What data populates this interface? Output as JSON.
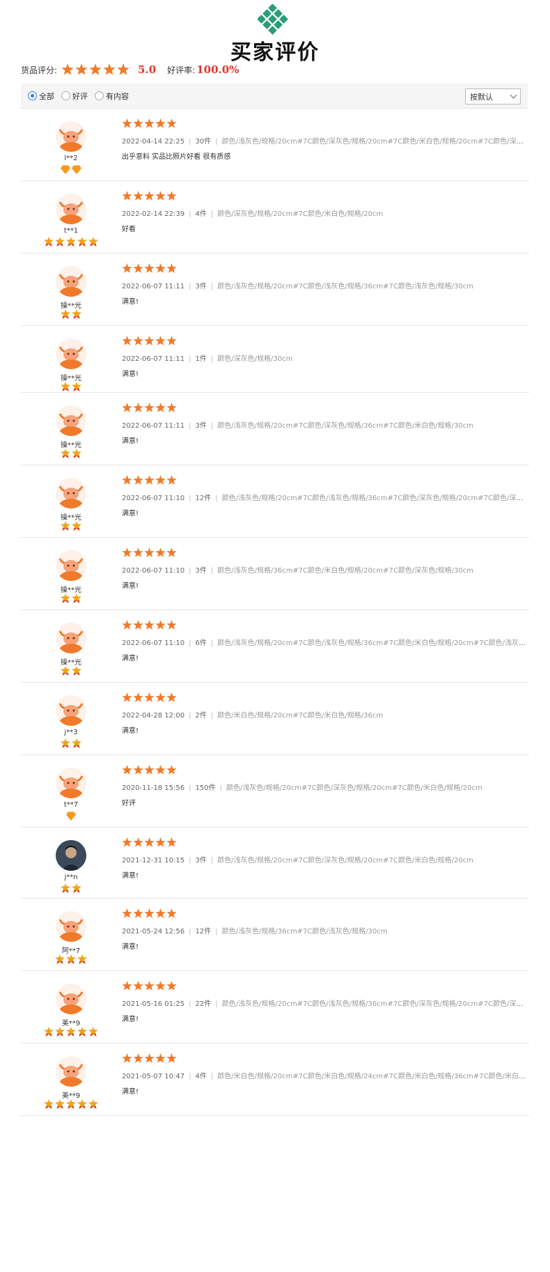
{
  "title": "买家评价",
  "summary": {
    "label": "货品评分:",
    "score": "5.0",
    "rate_label": "好评率:",
    "rate": "100.0%"
  },
  "filters": {
    "all": "全部",
    "good": "好评",
    "has_content": "有内容",
    "sort": "按默认"
  },
  "colors": {
    "accent": "#f07a29",
    "red": "#e6332a",
    "logo": "#2a9d78"
  },
  "reviews": [
    {
      "name": "l**2",
      "badge": "diamond",
      "badge_count": 2,
      "date": "2022-04-14 22:25",
      "qty": "30件",
      "spec": "颜色/浅灰色/规格/20cm#7C颜色/深灰色/规格/20cm#7C颜色/米白色/规格/20cm#7C颜色/深灰色/规格/...",
      "content": "出乎意料 实品比照片好看 很有质感"
    },
    {
      "name": "t**1",
      "badge": "crown",
      "badge_count": 5,
      "date": "2022-02-14 22:39",
      "qty": "4件",
      "spec": "颜色/深灰色/规格/20cm#7C颜色/米白色/规格/20cm",
      "content": "好看"
    },
    {
      "name": "操**光",
      "badge": "crown",
      "badge_count": 2,
      "date": "2022-06-07 11:11",
      "qty": "3件",
      "spec": "颜色/浅灰色/规格/20cm#7C颜色/浅灰色/规格/36cm#7C颜色/浅灰色/规格/30cm",
      "content": "满意!"
    },
    {
      "name": "操**光",
      "badge": "crown",
      "badge_count": 2,
      "date": "2022-06-07 11:11",
      "qty": "1件",
      "spec": "颜色/深灰色/规格/30cm",
      "content": "满意!"
    },
    {
      "name": "操**光",
      "badge": "crown",
      "badge_count": 2,
      "date": "2022-06-07 11:11",
      "qty": "3件",
      "spec": "颜色/浅灰色/规格/20cm#7C颜色/深灰色/规格/36cm#7C颜色/米白色/规格/30cm",
      "content": "满意!"
    },
    {
      "name": "操**光",
      "badge": "crown",
      "badge_count": 2,
      "date": "2022-06-07 11:10",
      "qty": "12件",
      "spec": "颜色/浅灰色/规格/20cm#7C颜色/浅灰色/规格/36cm#7C颜色/深灰色/规格/20cm#7C颜色/深灰色/规格/...",
      "content": "满意!"
    },
    {
      "name": "操**光",
      "badge": "crown",
      "badge_count": 2,
      "date": "2022-06-07 11:10",
      "qty": "3件",
      "spec": "颜色/浅灰色/规格/36cm#7C颜色/米白色/规格/20cm#7C颜色/深灰色/规格/30cm",
      "content": "满意!"
    },
    {
      "name": "操**光",
      "badge": "crown",
      "badge_count": 2,
      "date": "2022-06-07 11:10",
      "qty": "6件",
      "spec": "颜色/浅灰色/规格/20cm#7C颜色/浅灰色/规格/36cm#7C颜色/米白色/规格/20cm#7C颜色/浅灰色/规格/3...",
      "content": "满意!"
    },
    {
      "name": "j**3",
      "badge": "crown",
      "badge_count": 2,
      "date": "2022-04-28 12:00",
      "qty": "2件",
      "spec": "颜色/米白色/规格/20cm#7C颜色/米白色/规格/36cm",
      "content": "满意!"
    },
    {
      "name": "t**7",
      "badge": "diamond",
      "badge_count": 1,
      "date": "2020-11-18 15:56",
      "qty": "150件",
      "spec": "颜色/浅灰色/规格/20cm#7C颜色/深灰色/规格/20cm#7C颜色/米白色/规格/20cm",
      "content": "好评"
    },
    {
      "name": "j**n",
      "badge": "crown",
      "badge_count": 2,
      "photo": true,
      "date": "2021-12-31 10:15",
      "qty": "3件",
      "spec": "颜色/浅灰色/规格/20cm#7C颜色/深灰色/规格/20cm#7C颜色/米白色/规格/20cm",
      "content": "满意!"
    },
    {
      "name": "阿**7",
      "badge": "crown",
      "badge_count": 3,
      "date": "2021-05-24 12:56",
      "qty": "12件",
      "spec": "颜色/浅灰色/规格/36cm#7C颜色/浅灰色/规格/30cm",
      "content": "满意!"
    },
    {
      "name": "美**9",
      "badge": "crown",
      "badge_count": 5,
      "date": "2021-05-16 01:25",
      "qty": "22件",
      "spec": "颜色/浅灰色/规格/20cm#7C颜色/浅灰色/规格/36cm#7C颜色/深灰色/规格/20cm#7C颜色/深灰色/规格/...",
      "content": "满意!"
    },
    {
      "name": "美**9",
      "badge": "crown",
      "badge_count": 5,
      "date": "2021-05-07 10:47",
      "qty": "4件",
      "spec": "颜色/米白色/规格/20cm#7C颜色/米白色/规格/24cm#7C颜色/米白色/规格/36cm#7C颜色/米白色/规格/3...",
      "content": "满意!"
    }
  ]
}
